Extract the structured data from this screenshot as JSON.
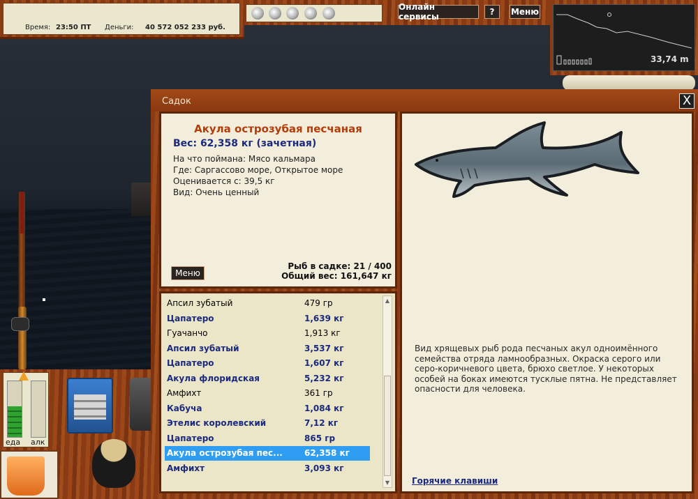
{
  "status": {
    "time_label": "Время:",
    "time_value": "23:50 ПТ",
    "money_label": "Деньги:",
    "money_value": "40 572 052 233 руб."
  },
  "topbar": {
    "online_services": "Онлайн сервисы",
    "help": "?",
    "menu": "Меню"
  },
  "depth": {
    "value": "33,74 m"
  },
  "gauges": {
    "food_label": "еда",
    "alc_label": "алк",
    "food_level": 0.55,
    "alc_level": 0.0
  },
  "dialog": {
    "title": "Садок",
    "close": "X",
    "fish": {
      "name": "Акула острозубая песчаная",
      "weight": "Вес: 62,358 кг (зачетная)",
      "caught_on": "На что поймана: Мясо кальмара",
      "where": "Где: Саргассово море, Открытое море",
      "valued_from": "Оценивается с: 39,5 кг",
      "kind": "Вид: Очень ценный"
    },
    "menu_button": "Меню",
    "fish_count": "Рыб в садке: 21 / 400",
    "total_weight": "Общий вес: 161,647 кг",
    "list": [
      {
        "name": "Апсил зубатый",
        "weight": "479 гр",
        "bold": false
      },
      {
        "name": "Цапатеро",
        "weight": "1,639 кг",
        "bold": true
      },
      {
        "name": "Гуачанчо",
        "weight": "1,913 кг",
        "bold": false
      },
      {
        "name": "Апсил зубатый",
        "weight": "3,537 кг",
        "bold": true
      },
      {
        "name": "Цапатеро",
        "weight": "1,607 кг",
        "bold": true
      },
      {
        "name": "Акула флоридская",
        "weight": "5,232 кг",
        "bold": true
      },
      {
        "name": "Амфихт",
        "weight": "361 гр",
        "bold": false
      },
      {
        "name": "Кабуча",
        "weight": "1,084 кг",
        "bold": true
      },
      {
        "name": "Этелис королевский",
        "weight": "7,12 кг",
        "bold": true
      },
      {
        "name": "Цапатеро",
        "weight": "865 гр",
        "bold": true
      },
      {
        "name": "Акула острозубая пес...",
        "weight": "62,358 кг",
        "bold": true,
        "selected": true
      },
      {
        "name": "Амфихт",
        "weight": "3,093 кг",
        "bold": true
      }
    ],
    "description": "Вид хрящевых рыб рода песчаных акул одноимённого семейства отряда ламнообразных. Окраска серого или серо-коричневого цвета, брюхо светлое. У некоторых особей на боках имеются тусклые пятна. Не представляет опасности для человека.",
    "hotkeys": "Горячие клавиши"
  }
}
